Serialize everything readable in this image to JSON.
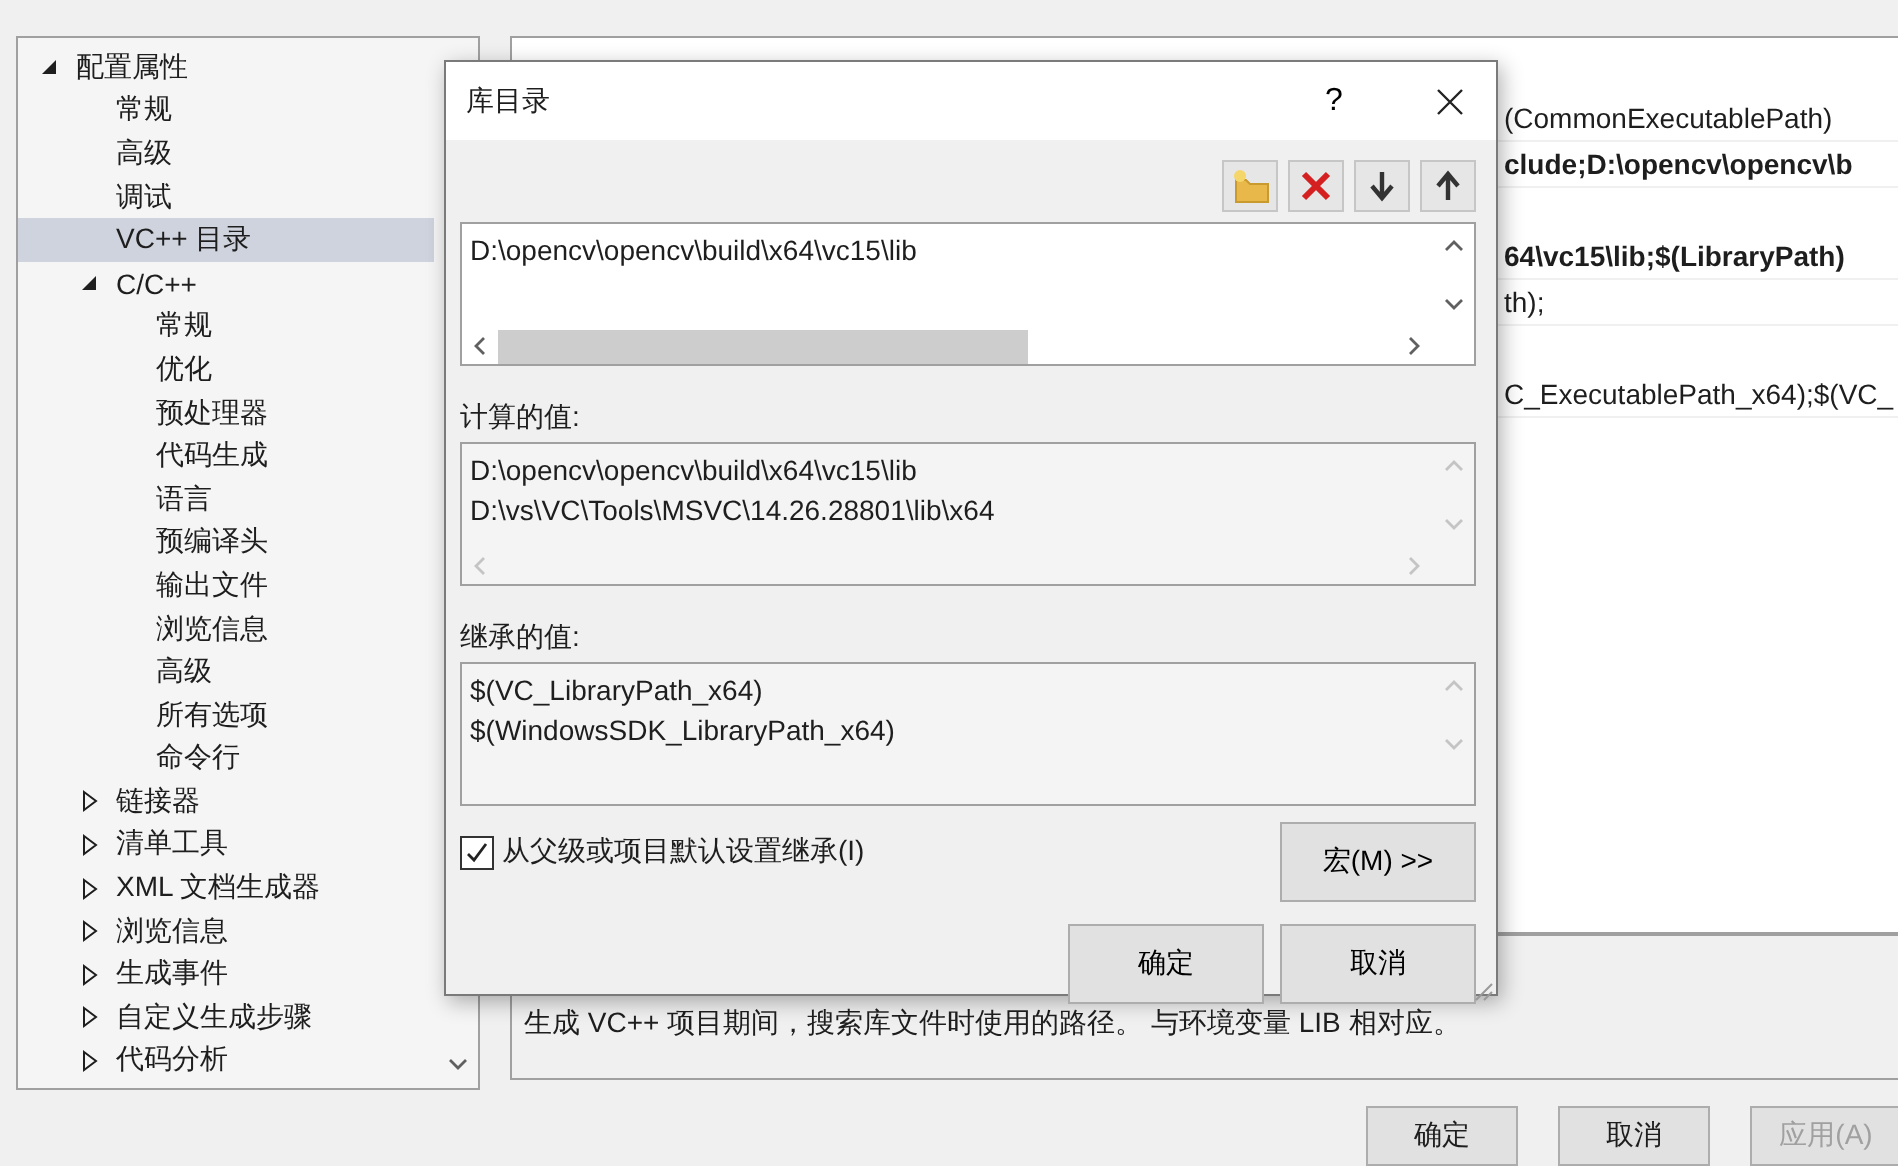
{
  "tree": [
    {
      "label": "配置属性",
      "expanded": true,
      "children": [
        {
          "label": "常规",
          "selected": false
        },
        {
          "label": "高级",
          "selected": false
        },
        {
          "label": "调试",
          "selected": false
        },
        {
          "label": "VC++ 目录",
          "selected": true
        },
        {
          "label": "C/C++",
          "expanded": true,
          "selected": false,
          "children": [
            {
              "label": "常规",
              "selected": false
            },
            {
              "label": "优化",
              "selected": false
            },
            {
              "label": "预处理器",
              "selected": false
            },
            {
              "label": "代码生成",
              "selected": false
            },
            {
              "label": "语言",
              "selected": false
            },
            {
              "label": "预编译头",
              "selected": false
            },
            {
              "label": "输出文件",
              "selected": false
            },
            {
              "label": "浏览信息",
              "selected": false
            },
            {
              "label": "高级",
              "selected": false
            },
            {
              "label": "所有选项",
              "selected": false
            },
            {
              "label": "命令行",
              "selected": false
            }
          ]
        },
        {
          "label": "链接器",
          "expanded": false,
          "selected": false
        },
        {
          "label": "清单工具",
          "expanded": false,
          "selected": false
        },
        {
          "label": "XML 文档生成器",
          "expanded": false,
          "selected": false
        },
        {
          "label": "浏览信息",
          "expanded": false,
          "selected": false
        },
        {
          "label": "生成事件",
          "expanded": false,
          "selected": false
        },
        {
          "label": "自定义生成步骤",
          "expanded": false,
          "selected": false
        },
        {
          "label": "代码分析",
          "expanded": false,
          "selected": false
        }
      ]
    }
  ],
  "property_rows": [
    {
      "value": "(CommonExecutablePath)",
      "bold": false,
      "after_hidden_row": false
    },
    {
      "value": "clude;D:\\opencv\\opencv\\b",
      "bold": true,
      "after_hidden_row": false
    },
    {
      "value": "64\\vc15\\lib;$(LibraryPath)",
      "bold": true,
      "after_hidden_row": true
    },
    {
      "value": "th);",
      "bold": false,
      "after_hidden_row": false
    },
    {
      "value": "C_ExecutablePath_x64);$(VC_",
      "bold": false,
      "after_hidden_row": true
    }
  ],
  "description": "生成 VC++ 项目期间，搜索库文件时使用的路径。 与环境变量 LIB 相对应。",
  "buttons": [
    {
      "label": "确定",
      "disabled": false
    },
    {
      "label": "取消",
      "disabled": false
    },
    {
      "label": "应用(A)",
      "disabled": true
    }
  ],
  "dialog": {
    "title": "库目录",
    "help": "?",
    "toolbar": [
      {
        "kind": "new-folder"
      },
      {
        "kind": "delete"
      },
      {
        "kind": "move-down"
      },
      {
        "kind": "move-up"
      }
    ],
    "entries": [
      "D:\\opencv\\opencv\\build\\x64\\vc15\\lib"
    ],
    "computed_label": "计算的值:",
    "computed": [
      "D:\\opencv\\opencv\\build\\x64\\vc15\\lib",
      "D:\\vs\\VC\\Tools\\MSVC\\14.26.28801\\lib\\x64"
    ],
    "inherited_label": "继承的值:",
    "inherited": [
      "$(VC_LibraryPath_x64)",
      "$(WindowsSDK_LibraryPath_x64)"
    ],
    "inherit": {
      "label": "从父级或项目默认设置继承(I)",
      "checked": true
    },
    "macros_button": "宏(M) >>",
    "buttons": [
      "确定",
      "取消"
    ]
  }
}
